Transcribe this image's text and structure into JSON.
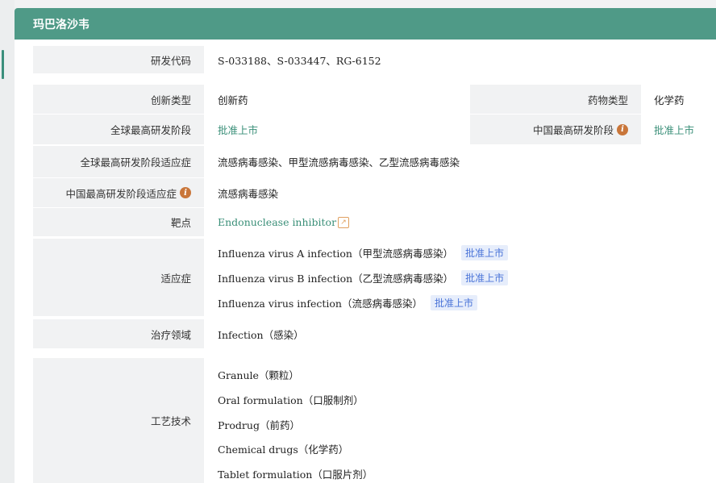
{
  "drug_name": "玛巴洛沙韦",
  "rows": {
    "code": {
      "label": "研发代码",
      "value": "S-033188、S-033447、RG-6152"
    },
    "innovation": {
      "label": "创新类型",
      "value": "创新药"
    },
    "drug_type": {
      "label": "药物类型",
      "value": "化学药"
    },
    "global_stage": {
      "label": "全球最高研发阶段",
      "value": "批准上市"
    },
    "china_stage": {
      "label": "中国最高研发阶段",
      "value": "批准上市"
    },
    "global_indication": {
      "label": "全球最高研发阶段适应症",
      "value": "流感病毒感染、甲型流感病毒感染、乙型流感病毒感染"
    },
    "china_indication": {
      "label": "中国最高研发阶段适应症",
      "value": "流感病毒感染"
    },
    "target": {
      "label": "靶点",
      "value": "Endonuclease inhibitor"
    },
    "indications": {
      "label": "适应症",
      "items": [
        {
          "name": "Influenza virus A infection（甲型流感病毒感染）",
          "status": "批准上市"
        },
        {
          "name": "Influenza virus B infection（乙型流感病毒感染）",
          "status": "批准上市"
        },
        {
          "name": "Influenza virus infection（流感病毒感染）",
          "status": "批准上市"
        }
      ]
    },
    "therapeutic_area": {
      "label": "治疗领域",
      "value": "Infection（感染）"
    },
    "technology": {
      "label": "工艺技术",
      "items": [
        "Granule（颗粒）",
        "Oral formulation（口服制剂）",
        "Prodrug（前药）",
        "Chemical drugs（化学药）",
        "Tablet formulation（口服片剂）"
      ]
    }
  },
  "icons": {
    "info": "info-icon",
    "external_link": "external-link-icon"
  },
  "colors": {
    "header": "#4f9a87",
    "link_green": "#3a8f78",
    "badge_bg": "#e6edfb",
    "badge_text": "#4a74d8",
    "info_icon": "#c9763a"
  }
}
